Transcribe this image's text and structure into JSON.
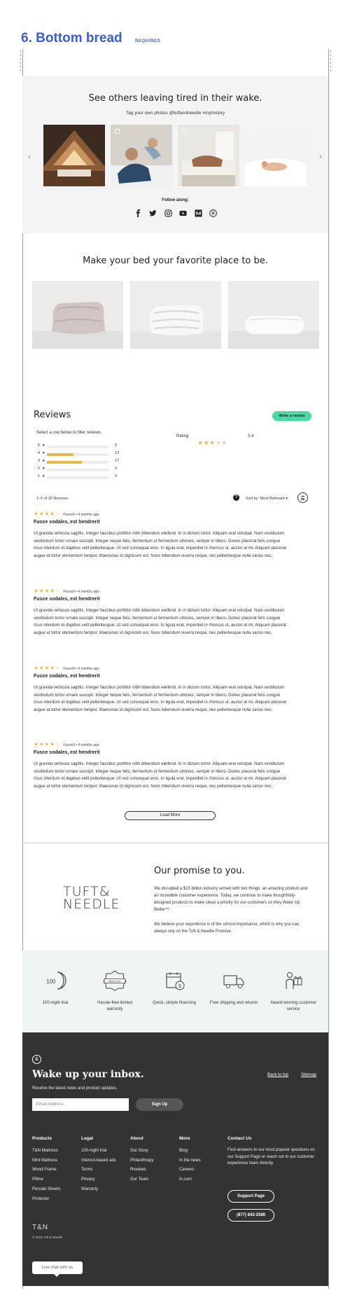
{
  "section": {
    "title": "6. Bottom bread",
    "badge": "REQUIRED"
  },
  "instagram": {
    "heading": "See others leaving tired in their wake.",
    "tagline": "Tag your own photos @tuftandneedle #mytnstory",
    "follow_label": "Follow along:",
    "socials": [
      "facebook-icon",
      "twitter-icon",
      "instagram-icon",
      "youtube-icon",
      "medium-icon",
      "pinterest-icon"
    ]
  },
  "bed": {
    "heading": "Make your bed your favorite place to be."
  },
  "reviews": {
    "title": "Reviews",
    "write_label": "Write a review",
    "filter_hint": "Select a row below to filter reviews.",
    "histogram": [
      {
        "stars": "5",
        "count": "0",
        "fraction": 0
      },
      {
        "stars": "4",
        "count": "13",
        "fraction": 0.43
      },
      {
        "stars": "3",
        "count": "17",
        "fraction": 0.57
      },
      {
        "stars": "2",
        "count": "0",
        "fraction": 0
      },
      {
        "stars": "1",
        "count": "0",
        "fraction": 0
      }
    ],
    "rating_label": "Rating",
    "rating_value": "3.4",
    "count_label": "1–6 of 30 Reviews",
    "sort_label": "Sort by: Most Relevant ▾",
    "items": [
      {
        "author": "Fusce9 • 4 months ago",
        "title": "Fusce sodales, est hendrerit",
        "body": "Ut gravida vehicula sagittis. Integer faucibus porttitor nibh bibendum eleifend. In in dictum tortor. Aliquam erat volutpat. Nam vestibulum vestibulum tortor ornare suscipit. Integer neque felis, fermentum ut fermentum ultricies, semper in libero. Donec placerat felis congue risus interdum et dapibus velit pellentesque. Ut sed consequat eros. In ligula erat, imperdiet in rhoncus ut, auctor at mi. Aliquam placerat augue at tortor elementum tempor. Maecenas id dignissim est. Nunc bibendum viverra neque, nec pellentesque nulla varius nec."
      },
      {
        "author": "Fusce9 • 4 months ago",
        "title": "Fusce sodales, est hendrerit",
        "body": "Ut gravida vehicula sagittis. Integer faucibus porttitor nibh bibendum eleifend. In in dictum tortor. Aliquam erat volutpat. Nam vestibulum vestibulum tortor ornare suscipit. Integer neque felis, fermentum ut fermentum ultricies, semper in libero. Donec placerat felis congue risus interdum et dapibus velit pellentesque. Ut sed consequat eros. In ligula erat, imperdiet in rhoncus ut, auctor at mi. Aliquam placerat augue at tortor elementum tempor. Maecenas id dignissim est. Nunc bibendum viverra neque, nec pellentesque nulla varius nec."
      },
      {
        "author": "Fusce9 • 4 months ago",
        "title": "Fusce sodales, est hendrerit",
        "body": "Ut gravida vehicula sagittis. Integer faucibus porttitor nibh bibendum eleifend. In in dictum tortor. Aliquam erat volutpat. Nam vestibulum vestibulum tortor ornare suscipit. Integer neque felis, fermentum ut fermentum ultricies, semper in libero. Donec placerat felis congue risus interdum et dapibus velit pellentesque. Ut sed consequat eros. In ligula erat, imperdiet in rhoncus ut, auctor at mi. Aliquam placerat augue at tortor elementum tempor. Maecenas id dignissim est. Nunc bibendum viverra neque, nec pellentesque nulla varius nec."
      },
      {
        "author": "Fusce9 • 4 months ago",
        "title": "Fusce sodales, est hendrerit",
        "body": "Ut gravida vehicula sagittis. Integer faucibus porttitor nibh bibendum eleifend. In in dictum tortor. Aliquam erat volutpat. Nam vestibulum vestibulum tortor ornare suscipit. Integer neque felis, fermentum ut fermentum ultricies, semper in libero. Donec placerat felis congue risus interdum et dapibus velit pellentesque. Ut sed consequat eros. In ligula erat, imperdiet in rhoncus ut, auctor at mi. Aliquam placerat augue at tortor elementum tempor. Maecenas id dignissim est. Nunc bibendum viverra neque, nec pellentesque nulla varius nec."
      }
    ],
    "load_more": "Load More"
  },
  "promise": {
    "logo_line1": "TUFT&",
    "logo_line2": "NEEDLE",
    "title": "Our promise to you.",
    "p1": "We disrupted a $15 billion industry armed with two things: an amazing product and an incredible customer experience. Today, we continue to make thoughtfully-designed products to make sleep a priority for our customers so they Wake Up Better™.",
    "p2": "We believe your experience is of the utmost importance, which is why you can always rely on the Tuft & Needle Promise."
  },
  "features": [
    {
      "label": "100-night trial",
      "icon": "moon-100-icon"
    },
    {
      "label": "Hassle-free limited warranty",
      "icon": "hassle-free-badge-icon"
    },
    {
      "label": "Quick, simple financing",
      "icon": "calendar-dollar-icon"
    },
    {
      "label": "Free shipping and returns",
      "icon": "truck-icon"
    },
    {
      "label": "Award-winning customer service",
      "icon": "person-gift-icon"
    }
  ],
  "hassle_badge_text": "Hassle-free",
  "moon_text": "100",
  "footer": {
    "heading": "Wake up your inbox.",
    "sub": "Receive the latest news and product updates.",
    "email_placeholder": "Email Address",
    "signup": "Sign Up",
    "back_to_top": "Back to top",
    "sitemap": "Sitemap",
    "columns": [
      {
        "title": "Products",
        "items": [
          "T&N Mattress",
          "Mint Mattress",
          "Wood Frame",
          "Pillow",
          "Percale Sheets",
          "Protector"
        ]
      },
      {
        "title": "Legal",
        "items": [
          "100-night trial",
          "Interest-based ads",
          "Terms",
          "Privacy",
          "Warranty"
        ]
      },
      {
        "title": "About",
        "items": [
          "Our Story",
          "Philanthropy",
          "Reviews",
          "Our Team"
        ]
      },
      {
        "title": "More",
        "items": [
          "Blog",
          "In the news",
          "Careers",
          "tn.com"
        ]
      }
    ],
    "contact_title": "Contact Us",
    "contact_text": "Find answers to our most popular questions on our Support Page or reach out to our customer experience team directly.",
    "support_btn": "Support Page",
    "phone_btn": "(877) 842-2586",
    "brand": "T&N",
    "copyright": "© 2018 Tuft & Needle",
    "chat": "Live chat with us"
  },
  "colors": {
    "accent_blue": "#3a5fc8",
    "review_green": "#4dd9a0",
    "star_gold": "#e8b84b",
    "footer_bg": "#333333",
    "features_bg": "#eef6ef"
  }
}
